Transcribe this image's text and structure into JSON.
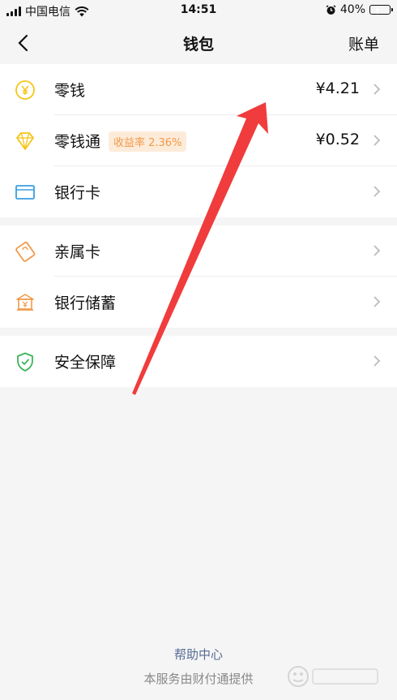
{
  "status_bar": {
    "carrier": "中国电信",
    "time": "14:51",
    "battery": "40%",
    "battery_level": 0.4
  },
  "nav": {
    "title": "钱包",
    "right_label": "账单",
    "back_icon": "chevron-left-icon"
  },
  "group1": [
    {
      "label": "零钱",
      "value": "¥4.21",
      "icon": "yuan-coin-icon"
    },
    {
      "label": "零钱通",
      "badge": "收益率 2.36%",
      "value": "¥0.52",
      "icon": "diamond-icon"
    },
    {
      "label": "银行卡",
      "value": "",
      "icon": "bank-card-icon"
    }
  ],
  "group2": [
    {
      "label": "亲属卡",
      "icon": "family-card-icon"
    },
    {
      "label": "银行储蓄",
      "icon": "bank-building-icon"
    }
  ],
  "group3": [
    {
      "label": "安全保障",
      "icon": "shield-check-icon"
    }
  ],
  "footer": {
    "help": "帮助中心",
    "provider": "本服务由财付通提供"
  },
  "colors": {
    "accent_yellow": "#f5c518",
    "bank_blue": "#3a9fe0",
    "orange": "#f09a4a",
    "green": "#3cb55a",
    "link": "#576b95",
    "arrow": "#f03c3c"
  }
}
